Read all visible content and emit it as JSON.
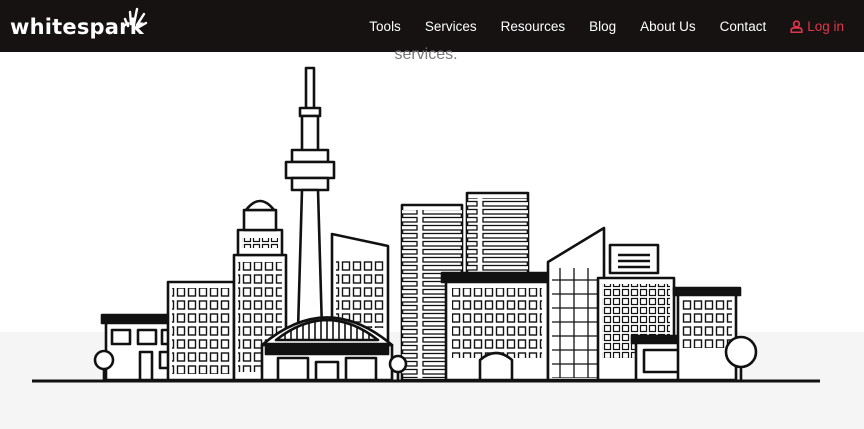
{
  "header": {
    "logo": "whitespark",
    "nav": [
      {
        "label": "Tools"
      },
      {
        "label": "Services"
      },
      {
        "label": "Resources"
      },
      {
        "label": "Blog"
      },
      {
        "label": "About Us"
      },
      {
        "label": "Contact"
      }
    ],
    "login_label": "Log in"
  },
  "hero": {
    "tail_text": "services."
  },
  "colors": {
    "navbar_bg": "#161212",
    "accent": "#e0364b",
    "text_muted": "#7a7a7a",
    "line": "#111111"
  },
  "icons": {
    "login": "user-icon",
    "logo_mark": "spark-icon"
  }
}
